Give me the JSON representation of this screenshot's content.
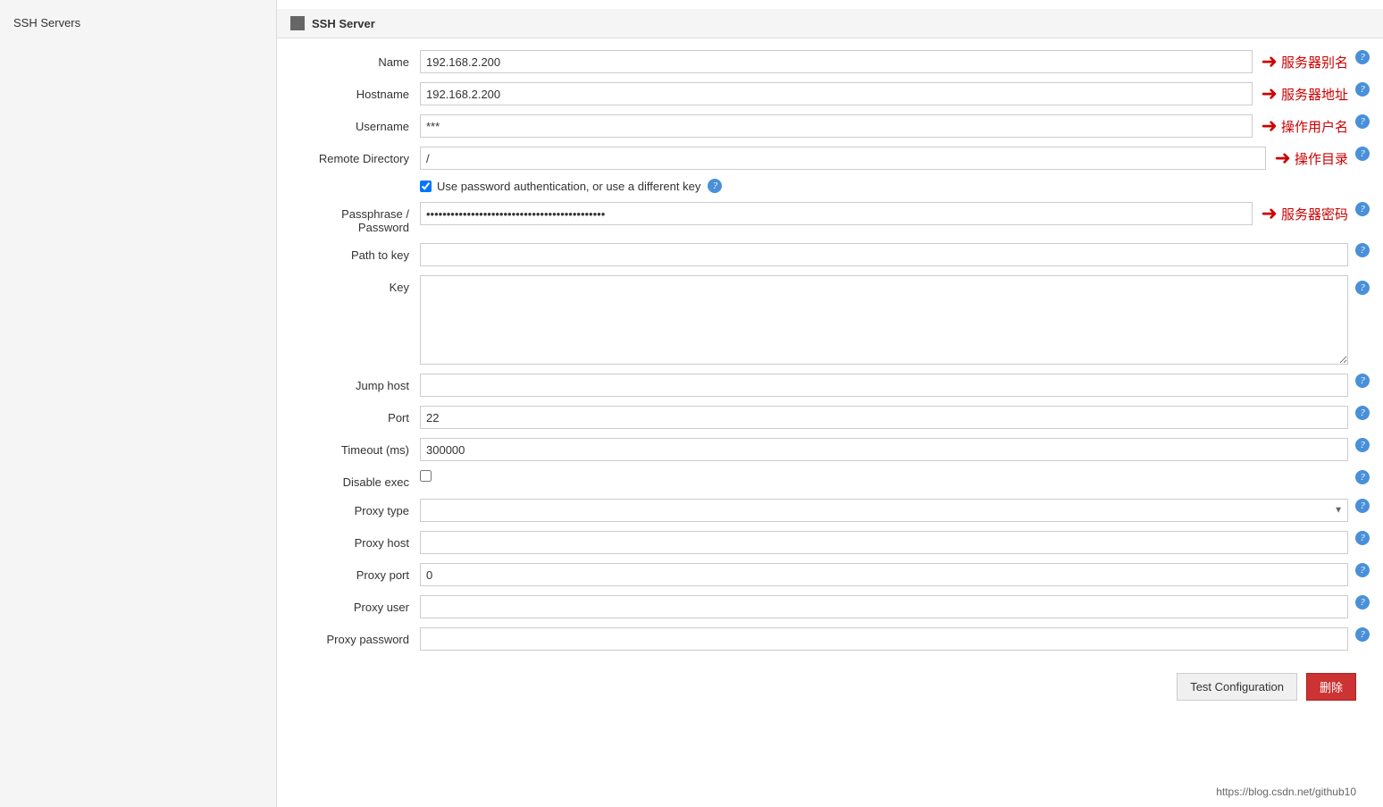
{
  "sidebar": {
    "title": "SSH Servers"
  },
  "section": {
    "title": "SSH Server"
  },
  "form": {
    "name_label": "Name",
    "name_value": "192.168.2.200",
    "name_annotation": "服务器别名",
    "hostname_label": "Hostname",
    "hostname_value": "192.168.2.200",
    "hostname_annotation": "服务器地址",
    "username_label": "Username",
    "username_value": "***",
    "username_annotation": "操作用户名",
    "remote_dir_label": "Remote Directory",
    "remote_dir_value": "/",
    "remote_dir_annotation": "操作目录",
    "use_password_label": "Use password authentication, or use a different key",
    "passphrase_label": "Passphrase / Password",
    "passphrase_value": "••••••••••••••••••••••••••••••••••••••••••••••••••••••••••••",
    "passphrase_annotation": "服务器密码",
    "path_to_key_label": "Path to key",
    "path_to_key_value": "",
    "key_label": "Key",
    "key_value": "",
    "jump_host_label": "Jump host",
    "jump_host_value": "",
    "port_label": "Port",
    "port_value": "22",
    "timeout_label": "Timeout (ms)",
    "timeout_value": "300000",
    "disable_exec_label": "Disable exec",
    "proxy_type_label": "Proxy type",
    "proxy_type_value": "",
    "proxy_host_label": "Proxy host",
    "proxy_host_value": "",
    "proxy_port_label": "Proxy port",
    "proxy_port_value": "0",
    "proxy_user_label": "Proxy user",
    "proxy_user_value": "",
    "proxy_password_label": "Proxy password",
    "proxy_password_value": ""
  },
  "buttons": {
    "test_config": "Test Configuration",
    "delete": "删除"
  },
  "url": "https://blog.csdn.net/github10",
  "help_icon": "?"
}
